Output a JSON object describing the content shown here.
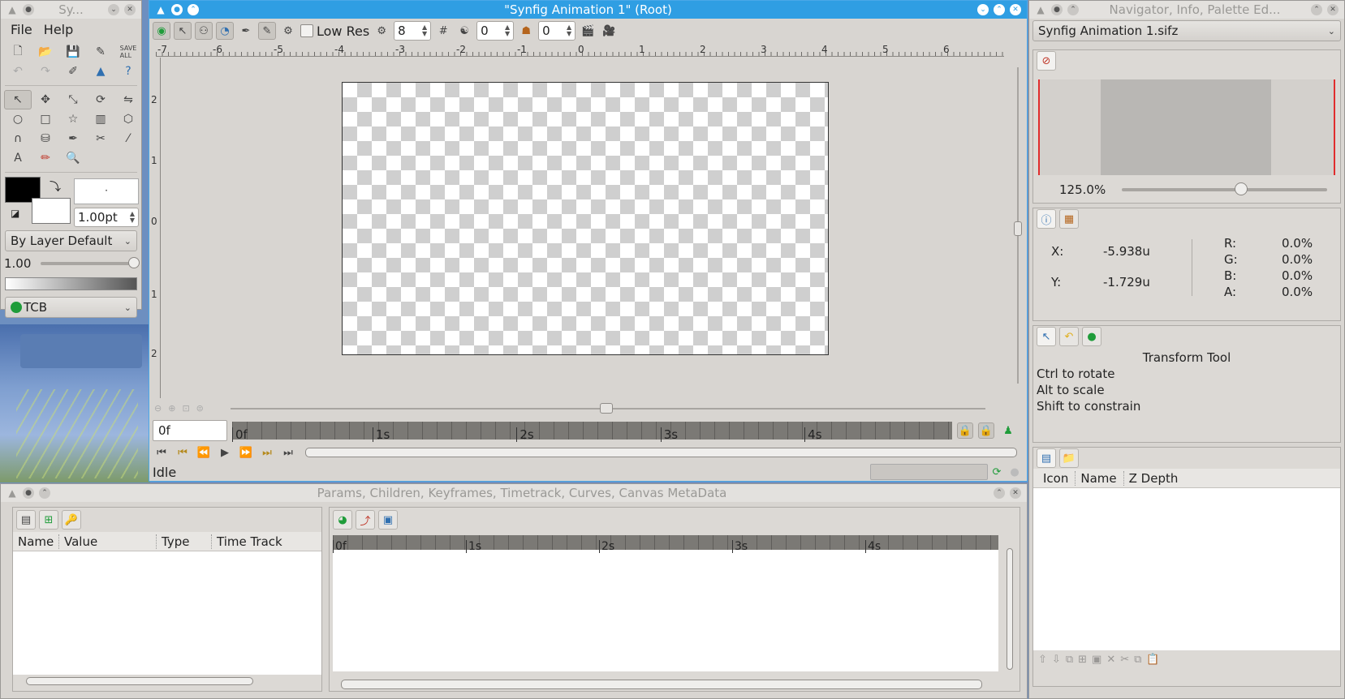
{
  "toolbox": {
    "title": "Sy...",
    "menu": [
      "File",
      "Help"
    ],
    "stroke_width": "1.00pt",
    "blend_method": "By Layer Default",
    "opacity": "1.00",
    "interpolation": "TCB"
  },
  "canvas": {
    "title": "\"Synfig Animation 1\" (Root)",
    "low_res_label": "Low Res",
    "resolution_value": "8",
    "onion_past": "0",
    "onion_future": "0",
    "ruler_h_labels": [
      "-7",
      "-6",
      "-5",
      "-4",
      "-3",
      "-2",
      "-1",
      "0",
      "1",
      "2",
      "3",
      "4",
      "5",
      "6"
    ],
    "ruler_v_labels": [
      "2",
      "1",
      "0",
      "1",
      "2"
    ],
    "current_frame": "0f",
    "timeline_labels": [
      "0f",
      "1s",
      "2s",
      "3s",
      "4s"
    ],
    "status": "Idle"
  },
  "rightdock": {
    "title": "Navigator, Info, Palette Ed...",
    "file_selector": "Synfig Animation 1.sifz",
    "zoom": "125.0%",
    "info": {
      "x_label": "X:",
      "x_value": "-5.938u",
      "y_label": "Y:",
      "y_value": "-1.729u",
      "r_label": "R:",
      "r_value": "0.0%",
      "g_label": "G:",
      "g_value": "0.0%",
      "b_label": "B:",
      "b_value": "0.0%",
      "a_label": "A:",
      "a_value": "0.0%"
    },
    "tool_options": {
      "heading": "Transform Tool",
      "lines": [
        "Ctrl to rotate",
        "Alt to scale",
        "Shift to constrain"
      ]
    },
    "layers_columns": [
      "Icon",
      "Name",
      "Z Depth"
    ]
  },
  "params": {
    "title": "Params, Children, Keyframes, Timetrack, Curves, Canvas MetaData",
    "columns": [
      "Name",
      "Value",
      "Type",
      "Time Track"
    ],
    "timetrack_labels": [
      "0f",
      "1s",
      "2s",
      "3s",
      "4s"
    ]
  },
  "colors": {
    "accent": "#2f9ee3",
    "stage_border": "#333333",
    "nav_frame": "#e02d2d",
    "status_ok": "#2ea84a"
  }
}
